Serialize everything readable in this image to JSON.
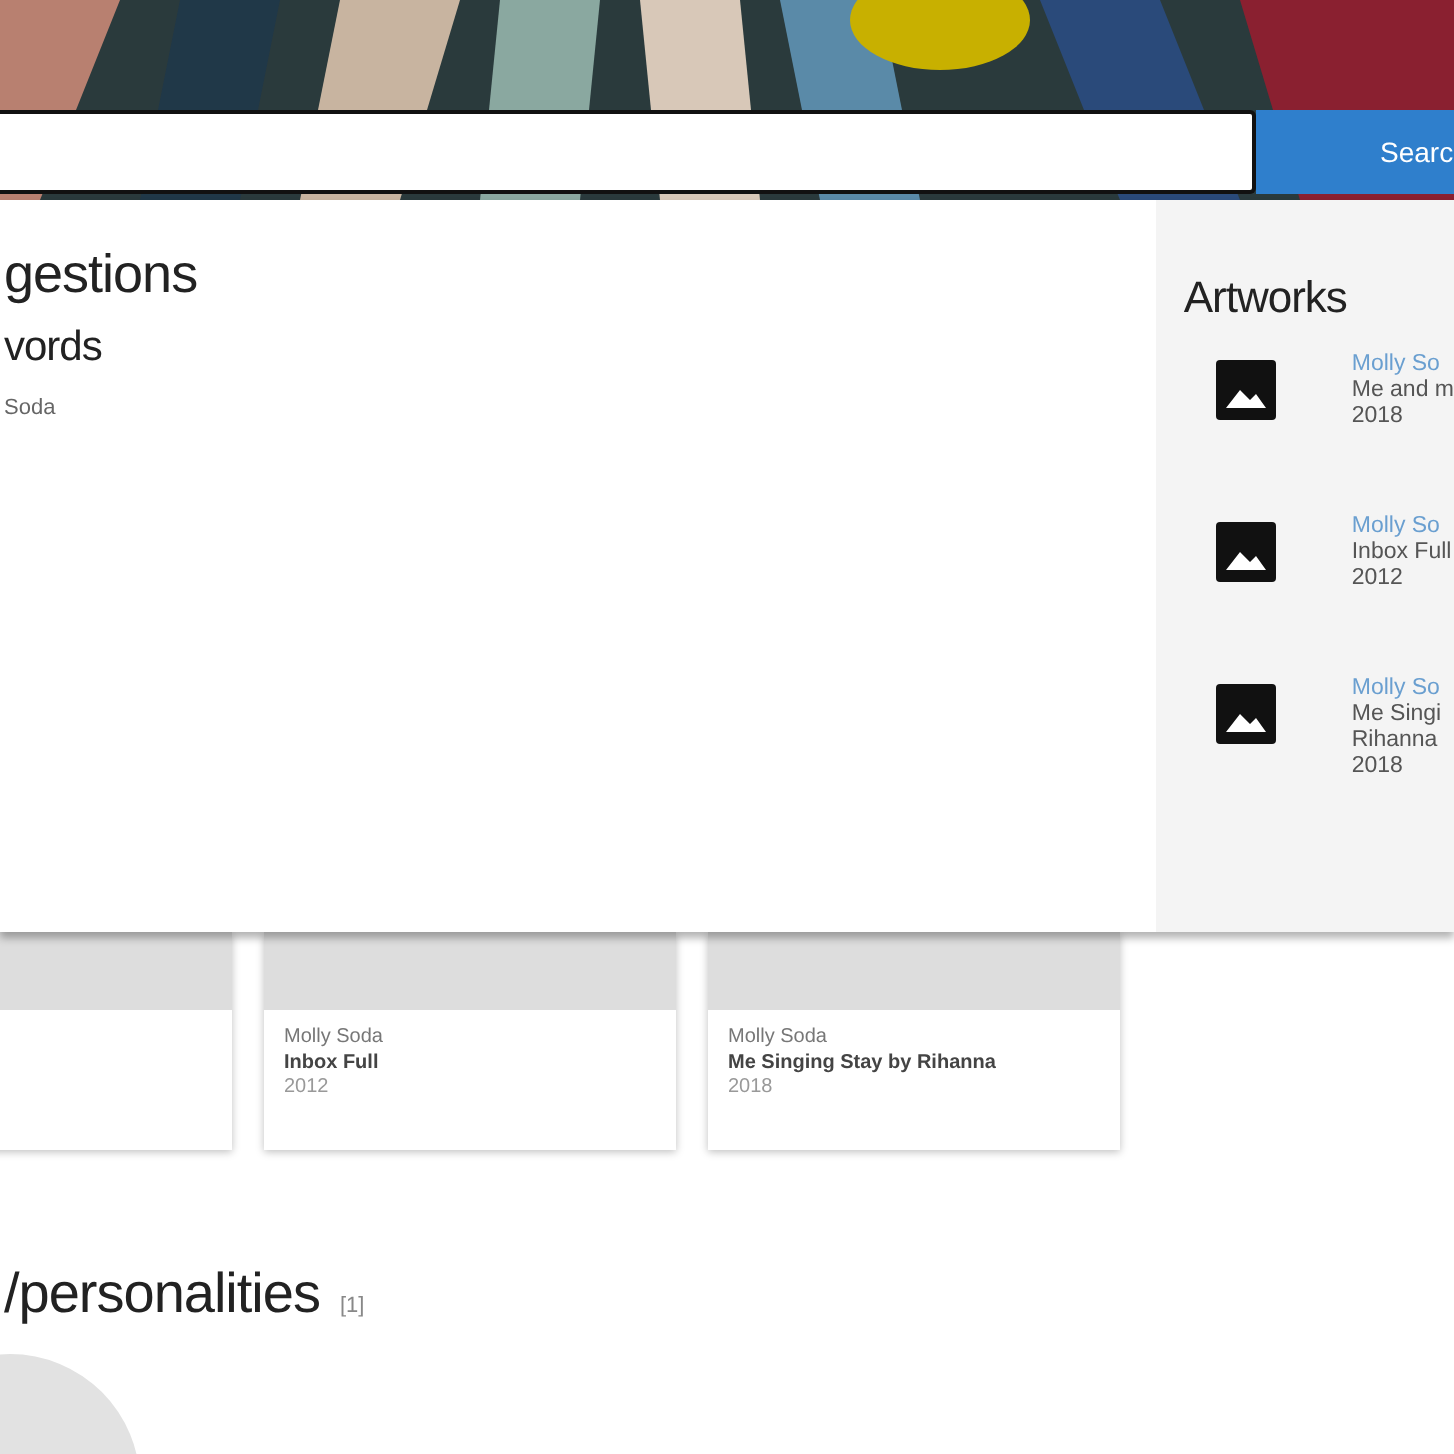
{
  "search": {
    "button": "Searc"
  },
  "suggestions": {
    "title": "gestions",
    "keywords_title": "vords",
    "keywords": [
      "Soda"
    ]
  },
  "artworks": {
    "title": "Artworks",
    "items": [
      {
        "artist": "Molly So",
        "title_lines": [
          "Me and m"
        ],
        "year": "2018"
      },
      {
        "artist": "Molly So",
        "title_lines": [
          "Inbox Full"
        ],
        "year": "2012"
      },
      {
        "artist": "Molly So",
        "title_lines": [
          "Me Singi",
          "Rihanna"
        ],
        "year": "2018"
      }
    ]
  },
  "cards": [
    {
      "kind": "cut"
    },
    {
      "kind": "full",
      "artist": "Molly Soda",
      "title": "Inbox Full",
      "year": "2012"
    },
    {
      "kind": "full",
      "artist": "Molly Soda",
      "title": "Me Singing Stay by Rihanna",
      "year": "2018"
    }
  ],
  "section": {
    "title": "/personalities",
    "count": "[1]"
  }
}
